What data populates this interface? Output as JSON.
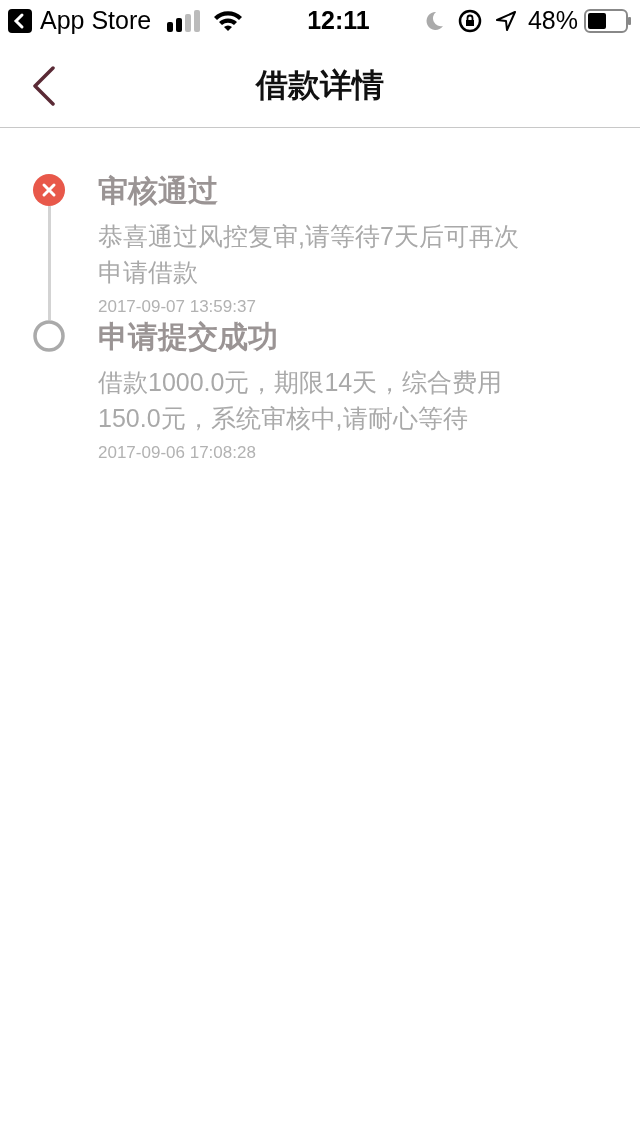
{
  "status_bar": {
    "back_app": "App Store",
    "time": "12:11",
    "battery": "48%"
  },
  "nav": {
    "title": "借款详情"
  },
  "timeline": [
    {
      "kind": "rejected",
      "title": "审核通过",
      "description": "恭喜通过风控复审,请等待7天后可再次申请借款",
      "time": "2017-09-07 13:59:37"
    },
    {
      "kind": "submitted",
      "title": "申请提交成功",
      "description": "借款1000.0元，期限14天，综合费用150.0元，系统审核中,请耐心等待",
      "time": "2017-09-06 17:08:28"
    }
  ]
}
